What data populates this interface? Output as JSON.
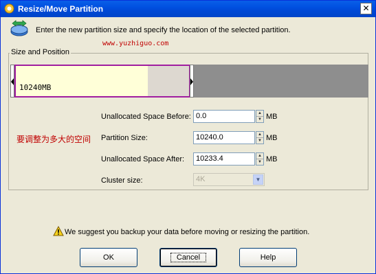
{
  "window": {
    "title": "Resize/Move Partition",
    "close_glyph": "✕"
  },
  "instruction": "Enter the new partition size and specify the location of the selected partition.",
  "watermark": "www.yuzhiguo.com",
  "group": {
    "title": "Size and Position",
    "partition_label": "10240MB",
    "used_fraction": 0.76
  },
  "annotation_text": "要调整为多大的空间",
  "fields": {
    "unallocated_before": {
      "label": "Unallocated Space Before:",
      "value": "0.0",
      "unit": "MB"
    },
    "partition_size": {
      "label": "Partition Size:",
      "value": "10240.0",
      "unit": "MB"
    },
    "unallocated_after": {
      "label": "Unallocated Space After:",
      "value": "10233.4",
      "unit": "MB"
    },
    "cluster_size": {
      "label": "Cluster size:",
      "value": "4K"
    }
  },
  "warning": "We suggest you backup your data before moving or resizing the partition.",
  "buttons": {
    "ok": "OK",
    "cancel": "Cancel",
    "help": "Help"
  },
  "icons": {
    "title": "app-icon",
    "header": "resize-partition-icon",
    "warning": "warning-icon"
  },
  "colors": {
    "titlebar": "#0050e0",
    "partition_border": "#a01ca0",
    "partition_used": "#ffffd8",
    "unallocated": "#8e8e8e",
    "annotation": "#c00000"
  }
}
